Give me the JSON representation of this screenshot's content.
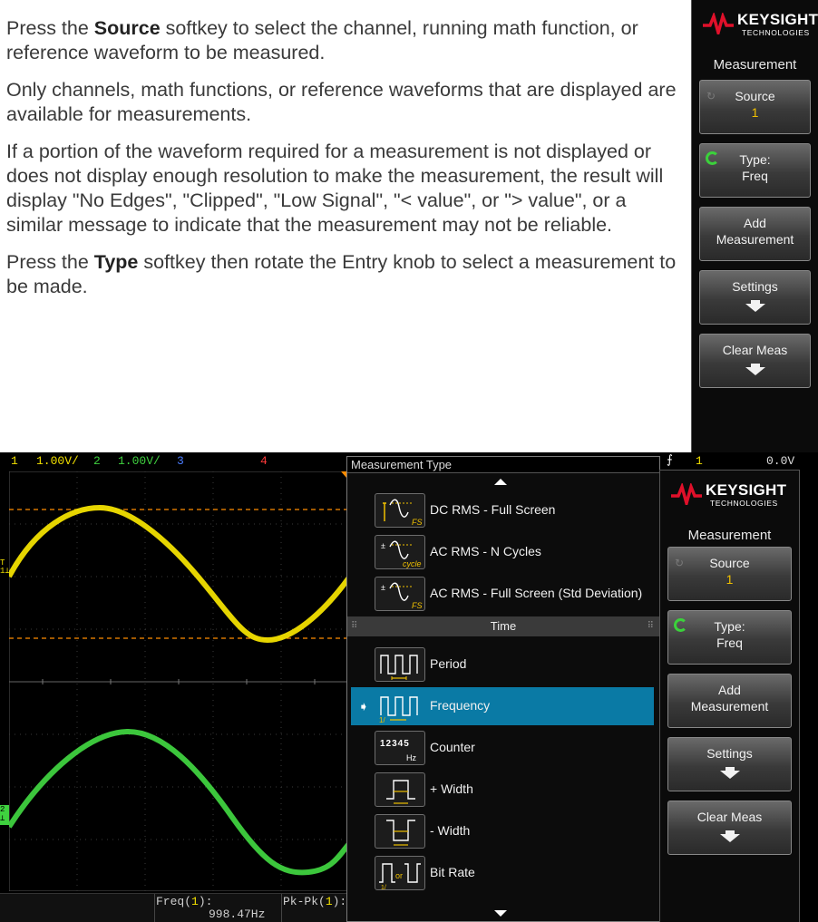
{
  "manual": {
    "p1_pre": "Press the ",
    "p1_bold": "Source",
    "p1_post": " softkey to select the channel, running math function, or reference waveform to be measured.",
    "p2": "Only channels, math functions, or reference waveforms that are displayed are available for measurements.",
    "p3": "If a portion of the waveform required for a measurement is not displayed or does not display enough resolution to make the measurement, the result will display \"No Edges\", \"Clipped\", \"Low Signal\", \"< value\", or \"> value\", or a similar message to indicate that the measurement may not be reliable.",
    "p4_pre": "Press the ",
    "p4_bold": "Type",
    "p4_post": " softkey then rotate the Entry knob to select a measurement to be made."
  },
  "softkeys": {
    "brand_name": "KEYSIGHT",
    "brand_sub": "TECHNOLOGIES",
    "menu_title": "Measurement",
    "source_label": "Source",
    "source_value": "1",
    "type_label": "Type:",
    "type_value": "Freq",
    "add_line1": "Add",
    "add_line2": "Measurement",
    "settings_label": "Settings",
    "clear_label": "Clear Meas"
  },
  "status_bar": {
    "ch1_num": "1",
    "ch1_scale": "1.00V/",
    "ch2_num": "2",
    "ch2_scale": "1.00V/",
    "ch3_num": "3",
    "ch4_num": "4",
    "trig_ch": "1",
    "trig_level": "0.0V"
  },
  "measurement_type": {
    "title": "Measurement Type",
    "items_top": [
      {
        "label": "DC RMS - Full Screen",
        "icon": "dc-rms-fs-icon",
        "tag": "FS"
      },
      {
        "label": "AC RMS - N Cycles",
        "icon": "ac-rms-cycle-icon",
        "tag": "cycle"
      },
      {
        "label": "AC RMS - Full Screen (Std Deviation)",
        "icon": "ac-rms-fs-icon",
        "tag": "FS"
      }
    ],
    "section_time": "Time",
    "items_time": [
      {
        "label": "Period",
        "icon": "period-icon"
      },
      {
        "label": "Frequency",
        "icon": "frequency-icon",
        "tag": "1/"
      },
      {
        "label": "Counter",
        "icon": "counter-icon",
        "digits": "12345",
        "unit": "Hz"
      },
      {
        "label": "+ Width",
        "icon": "plus-width-icon"
      },
      {
        "label": "- Width",
        "icon": "minus-width-icon"
      },
      {
        "label": "Bit Rate",
        "icon": "bit-rate-icon",
        "tag": "or",
        "tag2": "1/"
      }
    ],
    "selected": "Frequency"
  },
  "meas_bar": {
    "m1_name": "Freq(",
    "m1_ch": "1",
    "m1_end": "):",
    "m1_value": "998.47Hz",
    "m2_name": "Pk-Pk(",
    "m2_ch": "1",
    "m2_end": "):"
  },
  "colors": {
    "ch1": "#f2e000",
    "ch2": "#3fd13f",
    "ch3": "#4a7cff",
    "ch4": "#ff3a3a",
    "trigger": "#ff8c00",
    "selection": "#0a7aa5",
    "accent": "#f0c000"
  }
}
